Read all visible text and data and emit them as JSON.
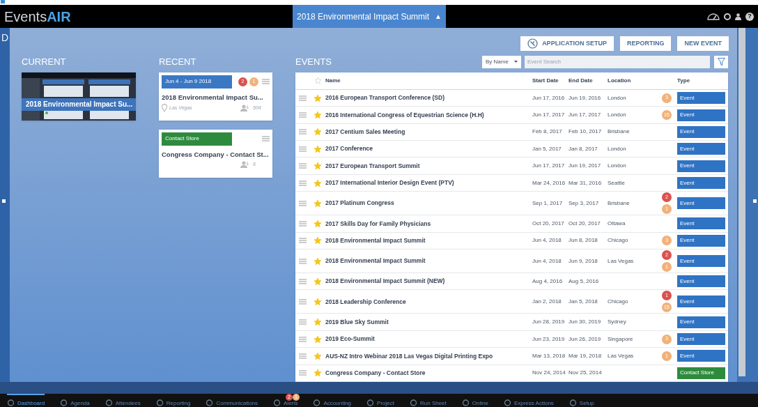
{
  "header": {
    "logo_left": "Events",
    "logo_right": "AIR",
    "event_title": "2018 Environmental Impact Summit",
    "title_caret": "▲",
    "help": "?"
  },
  "page_letter": "D",
  "toolbar": {
    "buttons": [
      {
        "label": "APPLICATION SETUP",
        "kind": "icon"
      },
      {
        "label": "REPORTING",
        "kind": "plain"
      },
      {
        "label": "NEW EVENT",
        "kind": "plain"
      }
    ]
  },
  "current": {
    "heading": "CURRENT",
    "card_title": "2018 Environmental Impact Su..."
  },
  "recent": {
    "heading": "RECENT",
    "cards": [
      {
        "kind": "event",
        "tag": "Jun 4 - Jun 9 2018",
        "color": "#3a78c3",
        "badges": [
          {
            "text": "2",
            "color": "#d9534f"
          },
          {
            "text": "1",
            "color": "#f0b27a"
          }
        ],
        "title": "2018 Environmental Impact Su...",
        "location": "Las Vegas",
        "count": "504"
      },
      {
        "kind": "store",
        "tag": "Contact Store",
        "color": "#2e8b3e",
        "title": "Congress Company - Contact St...",
        "count": "6"
      }
    ]
  },
  "events": {
    "heading": "EVENTS",
    "sort": "By Name",
    "search_placeholder": "Event Search",
    "columns": [
      "Name",
      "Start Date",
      "End Date",
      "Location",
      "Type"
    ],
    "rows": [
      {
        "name": "2016 European Transport Conference (SD)",
        "start": "Jun 17, 2016",
        "end": "Jun 19, 2016",
        "location": "London",
        "starred": true,
        "badges": [
          {
            "text": "3",
            "color": "#f0b27a"
          }
        ],
        "type": {
          "label": "Event",
          "color": "#2f73c4"
        }
      },
      {
        "name": "2016 International Congress of Equestrian Science (H.H)",
        "start": "Jun 17, 2017",
        "end": "Jun 17, 2017",
        "location": "London",
        "starred": true,
        "badges": [
          {
            "text": "15",
            "color": "#f0b27a"
          }
        ],
        "type": {
          "label": "Event",
          "color": "#2f73c4"
        }
      },
      {
        "name": "2017 Centium Sales Meeting",
        "start": "Feb 8, 2017",
        "end": "Feb 10, 2017",
        "location": "Brisbane",
        "starred": true,
        "type": {
          "label": "Event",
          "color": "#2f73c4"
        }
      },
      {
        "name": "2017 Conference",
        "start": "Jan 5, 2017",
        "end": "Jan 8, 2017",
        "location": "London",
        "starred": true,
        "type": {
          "label": "Event",
          "color": "#2f73c4"
        }
      },
      {
        "name": "2017 European Transport Summit",
        "start": "Jun 17, 2017",
        "end": "Jun 19, 2017",
        "location": "London",
        "starred": true,
        "type": {
          "label": "Event",
          "color": "#2f73c4"
        }
      },
      {
        "name": "2017 International Interior Design Event (PTV)",
        "start": "Mar 24, 2016",
        "end": "Mar 31, 2016",
        "location": "Seattle",
        "starred": true,
        "type": {
          "label": "Event",
          "color": "#2f73c4"
        }
      },
      {
        "name": "2017 Platinum Congress",
        "start": "Sep 1, 2017",
        "end": "Sep 3, 2017",
        "location": "Brisbane",
        "starred": true,
        "badges": [
          {
            "text": "2",
            "color": "#d9534f"
          },
          {
            "text": "1",
            "color": "#f0b27a"
          }
        ],
        "type": {
          "label": "Event",
          "color": "#2f73c4"
        }
      },
      {
        "name": "2017 Skills Day for Family Physicians",
        "start": "Oct 20, 2017",
        "end": "Oct 20, 2017",
        "location": "Ottawa",
        "starred": true,
        "type": {
          "label": "Event",
          "color": "#2f73c4"
        }
      },
      {
        "name": "2018 Environmental Impact Summit",
        "start": "Jun 4, 2018",
        "end": "Jun 8, 2018",
        "location": "Chicago",
        "starred": true,
        "badges": [
          {
            "text": "3",
            "color": "#f0b27a"
          }
        ],
        "type": {
          "label": "Event",
          "color": "#2f73c4"
        }
      },
      {
        "name": "2018 Environmental Impact Summit",
        "start": "Jun 4, 2018",
        "end": "Jun 9, 2018",
        "location": "Las Vegas",
        "starred": true,
        "badges": [
          {
            "text": "2",
            "color": "#d9534f"
          },
          {
            "text": "1",
            "color": "#f0b27a"
          }
        ],
        "type": {
          "label": "Event",
          "color": "#2f73c4"
        }
      },
      {
        "name": "2018 Environmental Impact Summit (NEW)",
        "start": "Aug 4, 2016",
        "end": "Aug 5, 2016",
        "starred": true,
        "type": {
          "label": "Event",
          "color": "#2f73c4"
        }
      },
      {
        "name": "2018 Leadership Conference",
        "start": "Jan 2, 2018",
        "end": "Jan 5, 2018",
        "location": "Chicago",
        "starred": true,
        "badges": [
          {
            "text": "1",
            "color": "#d9534f"
          },
          {
            "text": "15",
            "color": "#f0b27a"
          }
        ],
        "type": {
          "label": "Event",
          "color": "#2f73c4"
        }
      },
      {
        "name": "2019 Blue Sky Summit",
        "start": "Jun 28, 2019",
        "end": "Jun 30, 2019",
        "location": "Sydney",
        "starred": true,
        "type": {
          "label": "Event",
          "color": "#2f73c4"
        }
      },
      {
        "name": "2019 Eco-Summit",
        "start": "Jun 23, 2019",
        "end": "Jun 26, 2019",
        "location": "Singapore",
        "starred": true,
        "badges": [
          {
            "text": "3",
            "color": "#f0b27a"
          }
        ],
        "type": {
          "label": "Event",
          "color": "#2f73c4"
        }
      },
      {
        "name": "AUS-NZ Intro Webinar 2018 Las Vegas Digital Printing Expo",
        "start": "Mar 13, 2018",
        "end": "Mar 19, 2018",
        "location": "Las Vegas",
        "starred": true,
        "badges": [
          {
            "text": "1",
            "color": "#f0b27a"
          }
        ],
        "type": {
          "label": "Event",
          "color": "#2f73c4"
        }
      },
      {
        "name": "Congress Company - Contact Store",
        "start": "Nov 24, 2014",
        "end": "Nov 25, 2014",
        "starred": true,
        "type": {
          "label": "Contact Store",
          "color": "#2e8b3e"
        }
      }
    ]
  },
  "nav": [
    {
      "label": "Dashboard",
      "selected": true
    },
    {
      "label": "Agenda",
      "selected": false
    },
    {
      "label": "Attendees",
      "selected": false
    },
    {
      "label": "Reporting",
      "selected": false
    },
    {
      "label": "Communications",
      "selected": false
    },
    {
      "label": "Alerts",
      "selected": false,
      "badges": [
        {
          "text": "2",
          "color": "#d9534f"
        },
        {
          "text": "1",
          "color": "#f0b27a"
        }
      ]
    },
    {
      "label": "Accounting",
      "selected": false
    },
    {
      "label": "Project",
      "selected": false
    },
    {
      "label": "Run Sheet",
      "selected": false
    },
    {
      "label": "Online",
      "selected": false
    },
    {
      "label": "Express Actions",
      "selected": false
    },
    {
      "label": "Setup",
      "selected": false
    }
  ]
}
